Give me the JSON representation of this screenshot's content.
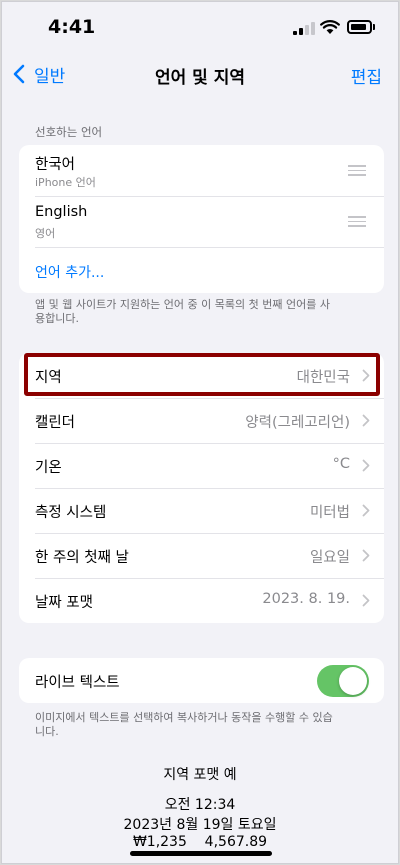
{
  "status_bar": {
    "time": "4:41",
    "icons": [
      "cellular-signal-icon",
      "wifi-icon",
      "battery-icon"
    ]
  },
  "nav": {
    "back_label": "일반",
    "title": "언어 및 지역",
    "edit_label": "편집"
  },
  "preferred_languages": {
    "header": "선호하는 언어",
    "items": [
      {
        "name": "한국어",
        "sub": "iPhone 언어"
      },
      {
        "name": "English",
        "sub": "영어"
      }
    ],
    "add_label": "언어 추가...",
    "footnote": "앱 및 웹 사이트가 지원하는 언어 중 이 목록의 첫 번째 언어를 사용합니다."
  },
  "region_settings": [
    {
      "label": "지역",
      "value": "대한민국"
    },
    {
      "label": "캘린더",
      "value": "양력(그레고리언)"
    },
    {
      "label": "기온",
      "value": "°C"
    },
    {
      "label": "측정 시스템",
      "value": "미터법"
    },
    {
      "label": "한 주의 첫째 날",
      "value": "일요일"
    },
    {
      "label": "날짜 포맷",
      "value": "2023. 8. 19."
    }
  ],
  "live_text": {
    "label": "라이브 텍스트",
    "enabled": true,
    "footnote": "이미지에서 텍스트를 선택하여 복사하거나 동작을 수행할 수 있습니다."
  },
  "region_format_example": {
    "title": "지역 포맷 예",
    "lines": [
      "오전 12:34",
      "2023년 8월 19일 토요일",
      "₩1,235    4,567.89"
    ]
  },
  "colors": {
    "accent": "#007aff",
    "toggle_on": "#65c466",
    "highlight_border": "#8b0000",
    "background": "#f2f2f7"
  }
}
